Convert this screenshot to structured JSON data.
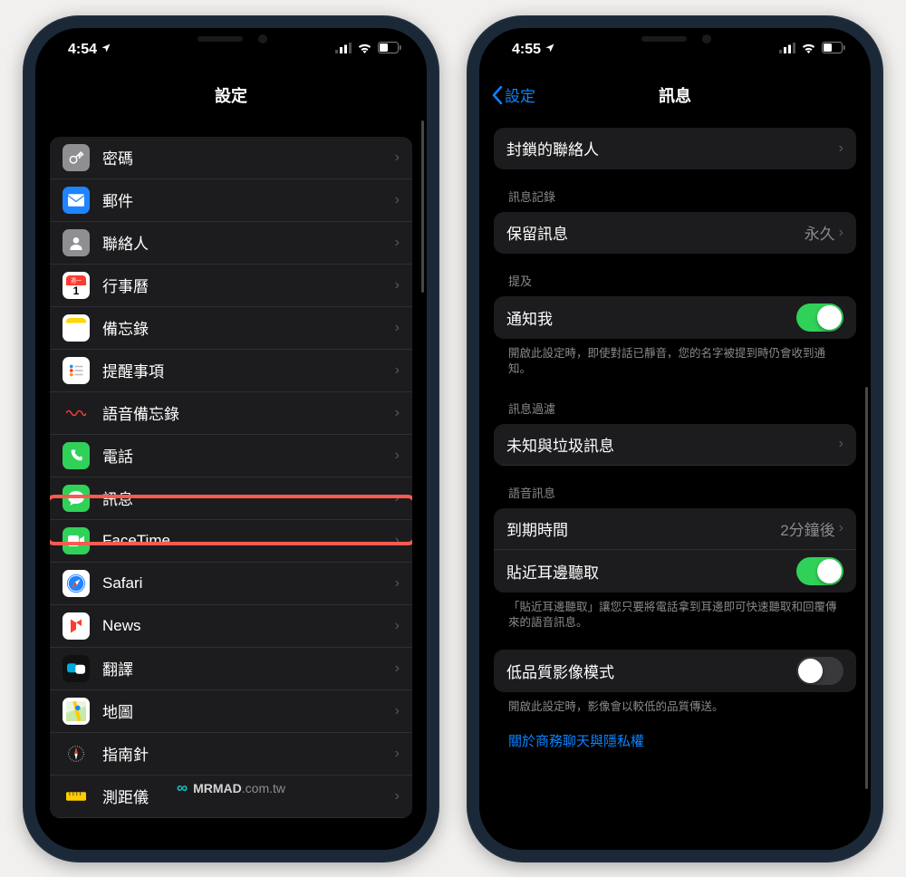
{
  "phone1": {
    "status": {
      "time": "4:54",
      "location_indicator": true
    },
    "nav": {
      "title": "設定"
    },
    "list": [
      {
        "label": "密碼",
        "icon_bg": "#8e8e93",
        "icon": "key"
      },
      {
        "label": "郵件",
        "icon_bg": "#1e84ff",
        "icon": "mail"
      },
      {
        "label": "聯絡人",
        "icon_bg": "#8e8e93",
        "icon": "person"
      },
      {
        "label": "行事曆",
        "icon_bg": "#ffffff",
        "icon": "calendar"
      },
      {
        "label": "備忘錄",
        "icon_bg": "#ffffff",
        "icon": "notes"
      },
      {
        "label": "提醒事項",
        "icon_bg": "#ffffff",
        "icon": "reminders"
      },
      {
        "label": "語音備忘錄",
        "icon_bg": "#1c1c1e",
        "icon": "voice"
      },
      {
        "label": "電話",
        "icon_bg": "#30d158",
        "icon": "phone"
      },
      {
        "label": "訊息",
        "icon_bg": "#30d158",
        "icon": "message",
        "highlighted": true
      },
      {
        "label": "FaceTime",
        "icon_bg": "#30d158",
        "icon": "facetime"
      },
      {
        "label": "Safari",
        "icon_bg": "#ffffff",
        "icon": "safari"
      },
      {
        "label": "News",
        "icon_bg": "#ffffff",
        "icon": "news"
      },
      {
        "label": "翻譯",
        "icon_bg": "#111111",
        "icon": "translate"
      },
      {
        "label": "地圖",
        "icon_bg": "#ffffff",
        "icon": "maps"
      },
      {
        "label": "指南針",
        "icon_bg": "#1c1c1e",
        "icon": "compass"
      },
      {
        "label": "測距儀",
        "icon_bg": "#1c1c1e",
        "icon": "measure"
      }
    ]
  },
  "phone2": {
    "status": {
      "time": "4:55",
      "location_indicator": true
    },
    "nav": {
      "title": "訊息",
      "back": "設定"
    },
    "sections": {
      "blocked": {
        "label": "封鎖的聯絡人"
      },
      "history_header": "訊息記錄",
      "keep": {
        "label": "保留訊息",
        "value": "永久"
      },
      "mentions_header": "提及",
      "notify_me": {
        "label": "通知我",
        "toggle": true
      },
      "notify_footer": "開啟此設定時，即使對話已靜音，您的名字被提到時仍會收到通知。",
      "filter_header": "訊息過濾",
      "unknown_spam": {
        "label": "未知與垃圾訊息",
        "highlighted": true
      },
      "audio_header": "語音訊息",
      "expire": {
        "label": "到期時間",
        "value": "2分鐘後"
      },
      "raise_listen": {
        "label": "貼近耳邊聽取",
        "toggle": true
      },
      "raise_footer": "「貼近耳邊聽取」讓您只要將電話拿到耳邊即可快速聽取和回覆傳來的語音訊息。",
      "low_quality": {
        "label": "低品質影像模式",
        "toggle": false
      },
      "low_quality_footer": "開啟此設定時，影像會以較低的品質傳送。",
      "privacy_link": "關於商務聊天與隱私權"
    }
  },
  "watermark": {
    "brand": "MRMAD",
    "suffix": ".com.tw"
  }
}
